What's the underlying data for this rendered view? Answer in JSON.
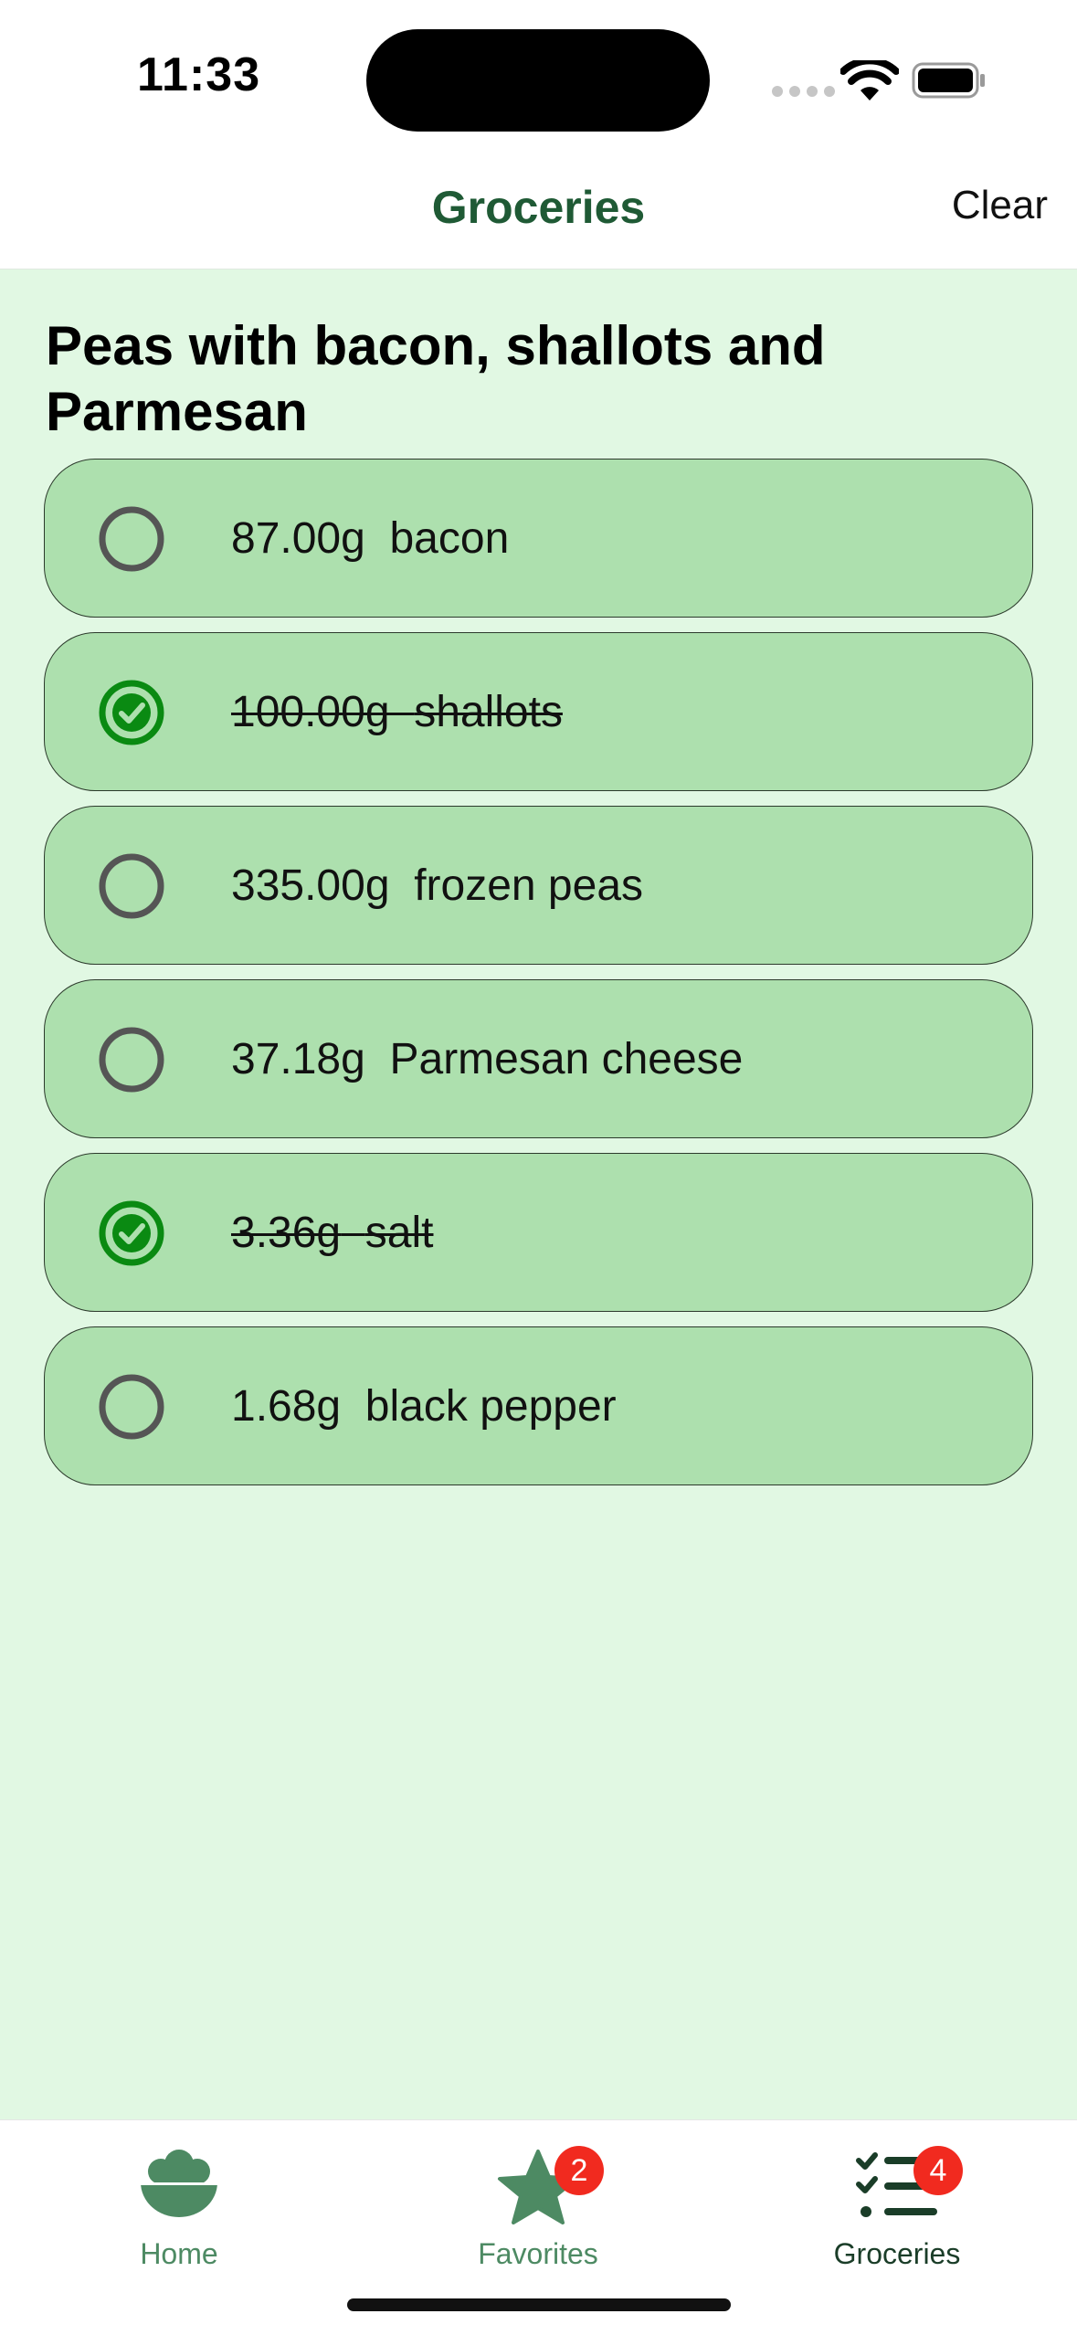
{
  "status_bar": {
    "time": "11:33"
  },
  "nav": {
    "title": "Groceries",
    "clear_label": "Clear"
  },
  "recipe": {
    "title": "Peas with bacon, shallots and Parmesan"
  },
  "items": [
    {
      "amount": "87.00g",
      "name": "bacon",
      "checked": false
    },
    {
      "amount": "100.00g",
      "name": "shallots",
      "checked": true
    },
    {
      "amount": "335.00g",
      "name": "frozen peas",
      "checked": false
    },
    {
      "amount": "37.18g",
      "name": "Parmesan cheese",
      "checked": false
    },
    {
      "amount": "3.36g",
      "name": "salt",
      "checked": true
    },
    {
      "amount": "1.68g",
      "name": "black pepper",
      "checked": false
    }
  ],
  "tabs": {
    "home": {
      "label": "Home",
      "icon": "bowl-icon"
    },
    "favorites": {
      "label": "Favorites",
      "icon": "star-icon",
      "badge": "2"
    },
    "groceries": {
      "label": "Groceries",
      "icon": "checklist-icon",
      "badge": "4"
    }
  },
  "colors": {
    "accent": "#1f5a35",
    "background": "#e1f8e3",
    "item_fill": "#ade0ae",
    "check_green": "#0a8a12",
    "badge": "#f12a1f"
  }
}
